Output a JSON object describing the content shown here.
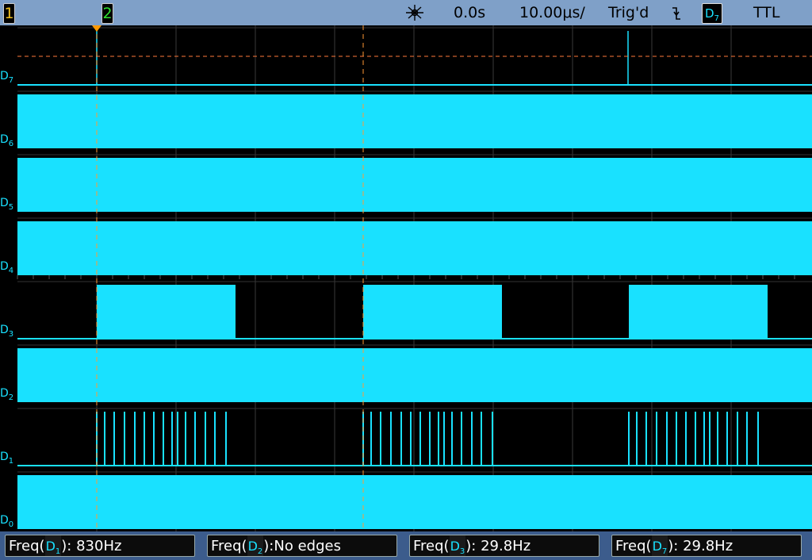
{
  "topbar": {
    "channel1": "1",
    "channel2": "2",
    "acquisition_icon": "acquire-icon",
    "delay": "0.0s",
    "timebase": "10.00μs/",
    "trigger_status": "Trig'd",
    "trigger_edge_icon": "falling-edge-icon",
    "trigger_source_letter": "D",
    "trigger_source_num": "7",
    "threshold": "TTL"
  },
  "channels": [
    {
      "letter": "D",
      "num": "7"
    },
    {
      "letter": "D",
      "num": "6"
    },
    {
      "letter": "D",
      "num": "5"
    },
    {
      "letter": "D",
      "num": "4"
    },
    {
      "letter": "D",
      "num": "3"
    },
    {
      "letter": "D",
      "num": "2"
    },
    {
      "letter": "D",
      "num": "1"
    },
    {
      "letter": "D",
      "num": "0"
    }
  ],
  "measurements": [
    {
      "prefix": "Freq(",
      "ch_letter": "D",
      "ch_num": "1",
      "suffix": "): 830Hz"
    },
    {
      "prefix": "Freq(",
      "ch_letter": "D",
      "ch_num": "2",
      "suffix": "):No edges"
    },
    {
      "prefix": "Freq(",
      "ch_letter": "D",
      "ch_num": "3",
      "suffix": "): 29.8Hz"
    },
    {
      "prefix": "Freq(",
      "ch_letter": "D",
      "ch_num": "7",
      "suffix": "): 29.8Hz"
    }
  ],
  "colors": {
    "trace": "#19e1ff",
    "marker1": "#f0c020",
    "marker2": "#30e030",
    "trigger_marker": "#ff9900",
    "toolbar": "#7fa0c8",
    "bottombar": "#3c5c8c"
  }
}
